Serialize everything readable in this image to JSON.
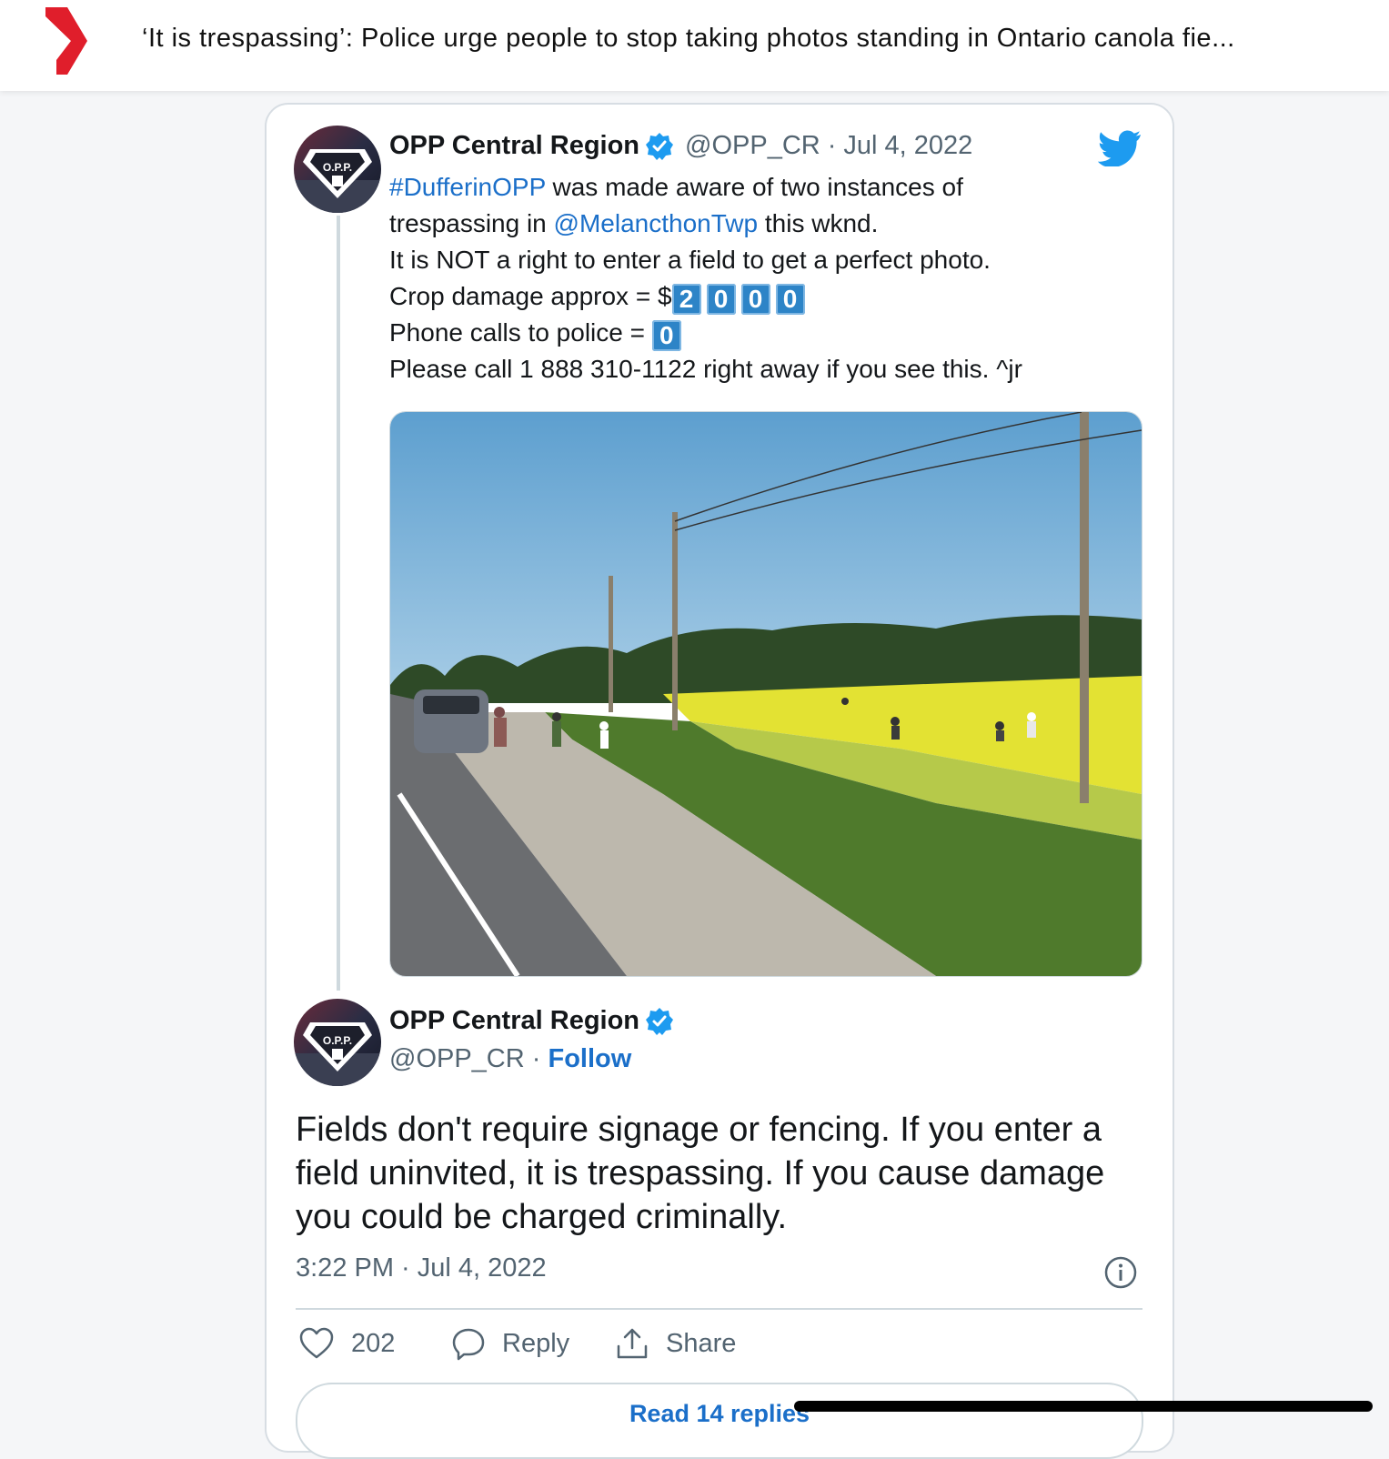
{
  "article": {
    "headline": "‘It is trespassing’: Police urge people to stop taking photos standing in Ontario canola fie...",
    "brand_color": "#e01e2b"
  },
  "tweet": {
    "display_name": "OPP Central Region",
    "handle": "@OPP_CR",
    "date_separator": "·",
    "date": "Jul 4, 2022",
    "avatar_label": "O.P.P.",
    "lines": {
      "l1_tag": "#DufferinOPP",
      "l1_rest": " was made aware of two instances of",
      "l2_pre": "trespassing in ",
      "l2_mention": "@MelancthonTwp",
      "l2_rest": " this wknd.",
      "l3": "It is NOT a right to enter a field to get a perfect photo.",
      "l4_pre": "Crop damage approx = $",
      "l4_digits": [
        "2",
        "0",
        "0",
        "0"
      ],
      "l5_pre": "Phone calls to police = ",
      "l5_digits": [
        "0"
      ],
      "l6": "Please call 1 888 310-1122 right away if you see this. ^jr"
    },
    "link_color": "#1b6fc9"
  },
  "reply": {
    "display_name": "OPP Central Region",
    "handle": "@OPP_CR",
    "separator": "·",
    "follow_label": "Follow",
    "text": "Fields don't require signage or fencing.  If you enter a field uninvited, it is trespassing.  If you cause damage you could be charged criminally.",
    "timestamp": "3:22 PM · Jul 4, 2022",
    "likes": "202",
    "reply_label": "Reply",
    "share_label": "Share",
    "read_replies_label": "Read 14 replies"
  },
  "icons": [
    "brand-logo-icon",
    "verified-badge-icon",
    "twitter-bird-icon",
    "info-icon",
    "heart-icon",
    "reply-bubble-icon",
    "share-icon"
  ]
}
